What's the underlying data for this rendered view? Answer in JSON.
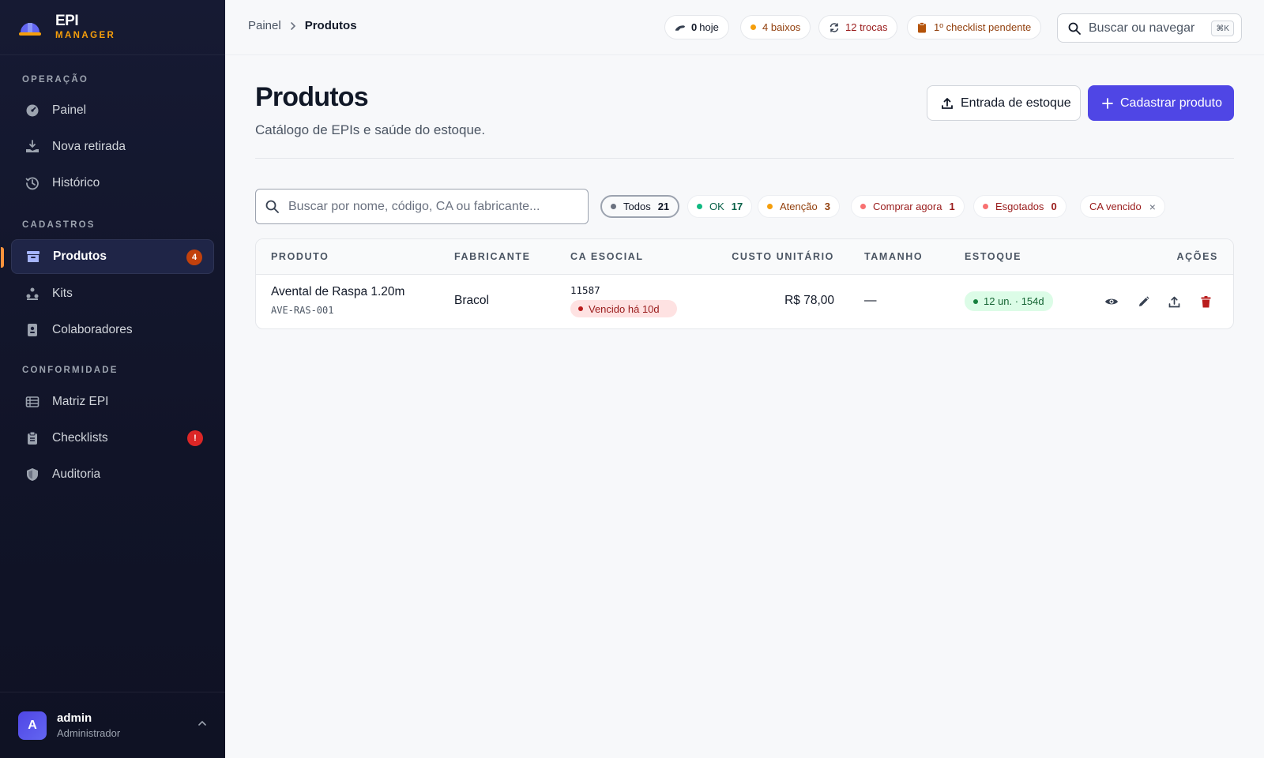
{
  "brand": {
    "title": "EPI",
    "subtitle": "MANAGER"
  },
  "sidebar": {
    "sections": [
      {
        "label": "OPERAÇÃO"
      },
      {
        "label": "CADASTROS"
      },
      {
        "label": "CONFORMIDADE"
      }
    ],
    "items": [
      {
        "label": "Painel",
        "icon": "dashboard-gauge-icon"
      },
      {
        "label": "Nova retirada",
        "icon": "hand-receive-icon"
      },
      {
        "label": "Histórico",
        "icon": "history-icon"
      },
      {
        "label": "Produtos",
        "icon": "box-icon",
        "active": true,
        "badge": "4"
      },
      {
        "label": "Kits",
        "icon": "kits-icon"
      },
      {
        "label": "Colaboradores",
        "icon": "id-badge-icon"
      },
      {
        "label": "Matriz EPI",
        "icon": "table-icon"
      },
      {
        "label": "Checklists",
        "icon": "clipboard-icon",
        "badge": "!"
      },
      {
        "label": "Auditoria",
        "icon": "shield-icon"
      }
    ]
  },
  "user": {
    "initial": "A",
    "name": "admin",
    "role": "Administrador"
  },
  "topbar": {
    "breadcrumb": {
      "parent": "Painel",
      "current": "Produtos"
    },
    "chips": [
      {
        "value": "0",
        "label": "hoje",
        "icon": "glove-icon"
      },
      {
        "label": "4 baixos",
        "color": "#f59e0b"
      },
      {
        "label": "12 trocas",
        "icon": "refresh-icon",
        "color": "#991b1b"
      },
      {
        "label": "1º checklist pendente",
        "icon": "clipboard-icon",
        "color": "#92400e"
      }
    ],
    "search": {
      "placeholder": "Buscar ou navegar",
      "shortcut": "⌘K"
    }
  },
  "page": {
    "title": "Produtos",
    "subtitle": "Catálogo de EPIs e saúde do estoque.",
    "actions": {
      "stock_entry": "Entrada de estoque",
      "register": "Cadastrar produto"
    },
    "search_placeholder": "Buscar por nome, código, CA ou fabricante...",
    "filters": [
      {
        "label": "Todos",
        "count": "21",
        "color": "#6b7280",
        "text": "#111827"
      },
      {
        "label": "OK",
        "count": "17",
        "color": "#10b981",
        "text": "#065f46"
      },
      {
        "label": "Atenção",
        "count": "3",
        "color": "#f59e0b",
        "text": "#92400e"
      },
      {
        "label": "Comprar agora",
        "count": "1",
        "color": "#f87171",
        "text": "#991b1b"
      },
      {
        "label": "Esgotados",
        "count": "0",
        "color": "#f87171",
        "text": "#991b1b"
      },
      {
        "label": "CA vencido",
        "close": "×",
        "text": "#991b1b"
      }
    ]
  },
  "table": {
    "columns": [
      "PRODUTO",
      "FABRICANTE",
      "CA ESOCIAL",
      "CUSTO UNITÁRIO",
      "TAMANHO",
      "ESTOQUE",
      "AÇÕES"
    ],
    "rows": [
      {
        "name": "Avental de Raspa 1.20m",
        "code": "AVE-RAS-001",
        "manufacturer": "Bracol",
        "ca": "11587",
        "ca_status": "Vencido há 10d",
        "cost": "R$ 78,00",
        "size": "—",
        "stock": "12 un. · 154d"
      }
    ]
  },
  "colors": {
    "accent": "#4f46e5",
    "sidebar_bg": "#141830",
    "warning": "#f59e0b",
    "danger": "#b91c1c",
    "success": "#15803d"
  }
}
